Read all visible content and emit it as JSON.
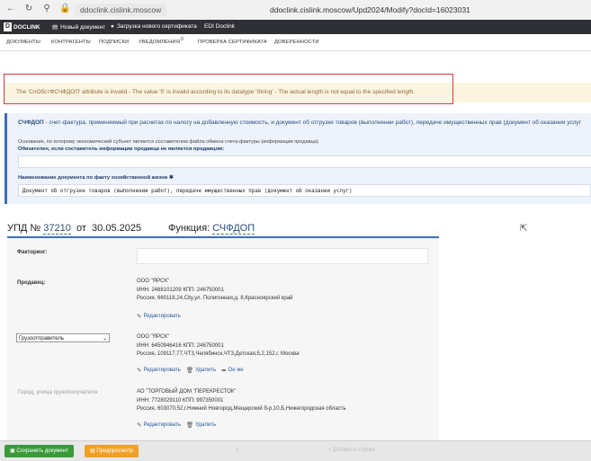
{
  "browser": {
    "url_short": "ddoclink.cislink.moscow",
    "url_full": "ddoclink.cislink.moscow/Upd2024/Modify?docId=16023031"
  },
  "app_header": {
    "logo": "DOCLINK",
    "new_doc": "Новый документ",
    "upload_cert": "Загрузка нового сертификата",
    "edi": "EDI Doclink"
  },
  "menu": {
    "items": [
      "ДОКУМЕНТЫ",
      "КОНТРАГЕНТЫ",
      "ПОДПИСКИ",
      "УВЕДОМЛЕНИЯ",
      "ПРОВЕРКА СЕРТИФИКАТА",
      "ДОВЕРЕННОСТИ"
    ],
    "notifications_count": "0"
  },
  "error": {
    "message": "The 'СпОбстФСЧФДОП' attribute is invalid - The value '5' is invalid according to its datatype 'String' - The actual length is not equal to the specified length."
  },
  "info": {
    "title_bold": "СЧФДОП",
    "title_rest": " - счет-фактура, применяемый при расчетах по налогу на добавленную стоимость, и документ об отгрузке товаров (выполнении работ), передаче имущественных прав (документ об оказании услуг",
    "basis": "Основание, по которому экономический субъект является составителем файла обмена счета-фактуры (информации продавца)",
    "required": "Обязателен, если составитель информации продавца не является продавцом:",
    "doc_name_label": "Наименование документа по факту хозяйственной жизни ✱",
    "doc_name_value": "Документ об отгрузке товаров (выполнении работ), передаче имущественных прав (документ об оказании услуг)"
  },
  "upd": {
    "prefix": "УПД №",
    "number": "37210",
    "from": "от",
    "date": "30.05.2025",
    "func_label": "Функция:",
    "func_value": "СЧФДОП"
  },
  "form": {
    "factoring_label": "Факторинг:",
    "seller_label": "Продавец:",
    "seller": {
      "name": "ООО \"ЯРСК\"",
      "inn_line": "ИНН: 2468101209 КПП: 246750001",
      "address": "Россия, 660118,24,City,ул. Полигонная,д. 8,Красноярский край",
      "edit": "Редактировать"
    },
    "shipper_select": "Грузоотправитель",
    "shipper": {
      "name": "ООО \"ЯРСК\"",
      "inn_line": "ИНН: 6450946416 КПП: 246750001",
      "address": "Россия, 109117,77,ЧТЗ,Челябинск,ЧТЗ,Детская,5,2,152,г. Москва",
      "edit": "Редактировать",
      "delete": "Удалить",
      "same": "Он же"
    },
    "consignee_label": "Город, улица грузополучателя",
    "consignee": {
      "name": "АО \"ТОРГОВЫЙ ДОМ \"ПЕРЕКРЕСТОК\"",
      "inn_line": "ИНН: 7728029110 КПП: 997350001",
      "address": "Россия, 603070,52,г.Нижний Новгород,Мещерский б-р,10,Б,Нижегородская область",
      "edit": "Редактировать",
      "delete": "Удалить"
    }
  },
  "bottom": {
    "save": "Сохранить документ",
    "preview": "Предпросмотр",
    "add_row": "Добавить строку"
  }
}
